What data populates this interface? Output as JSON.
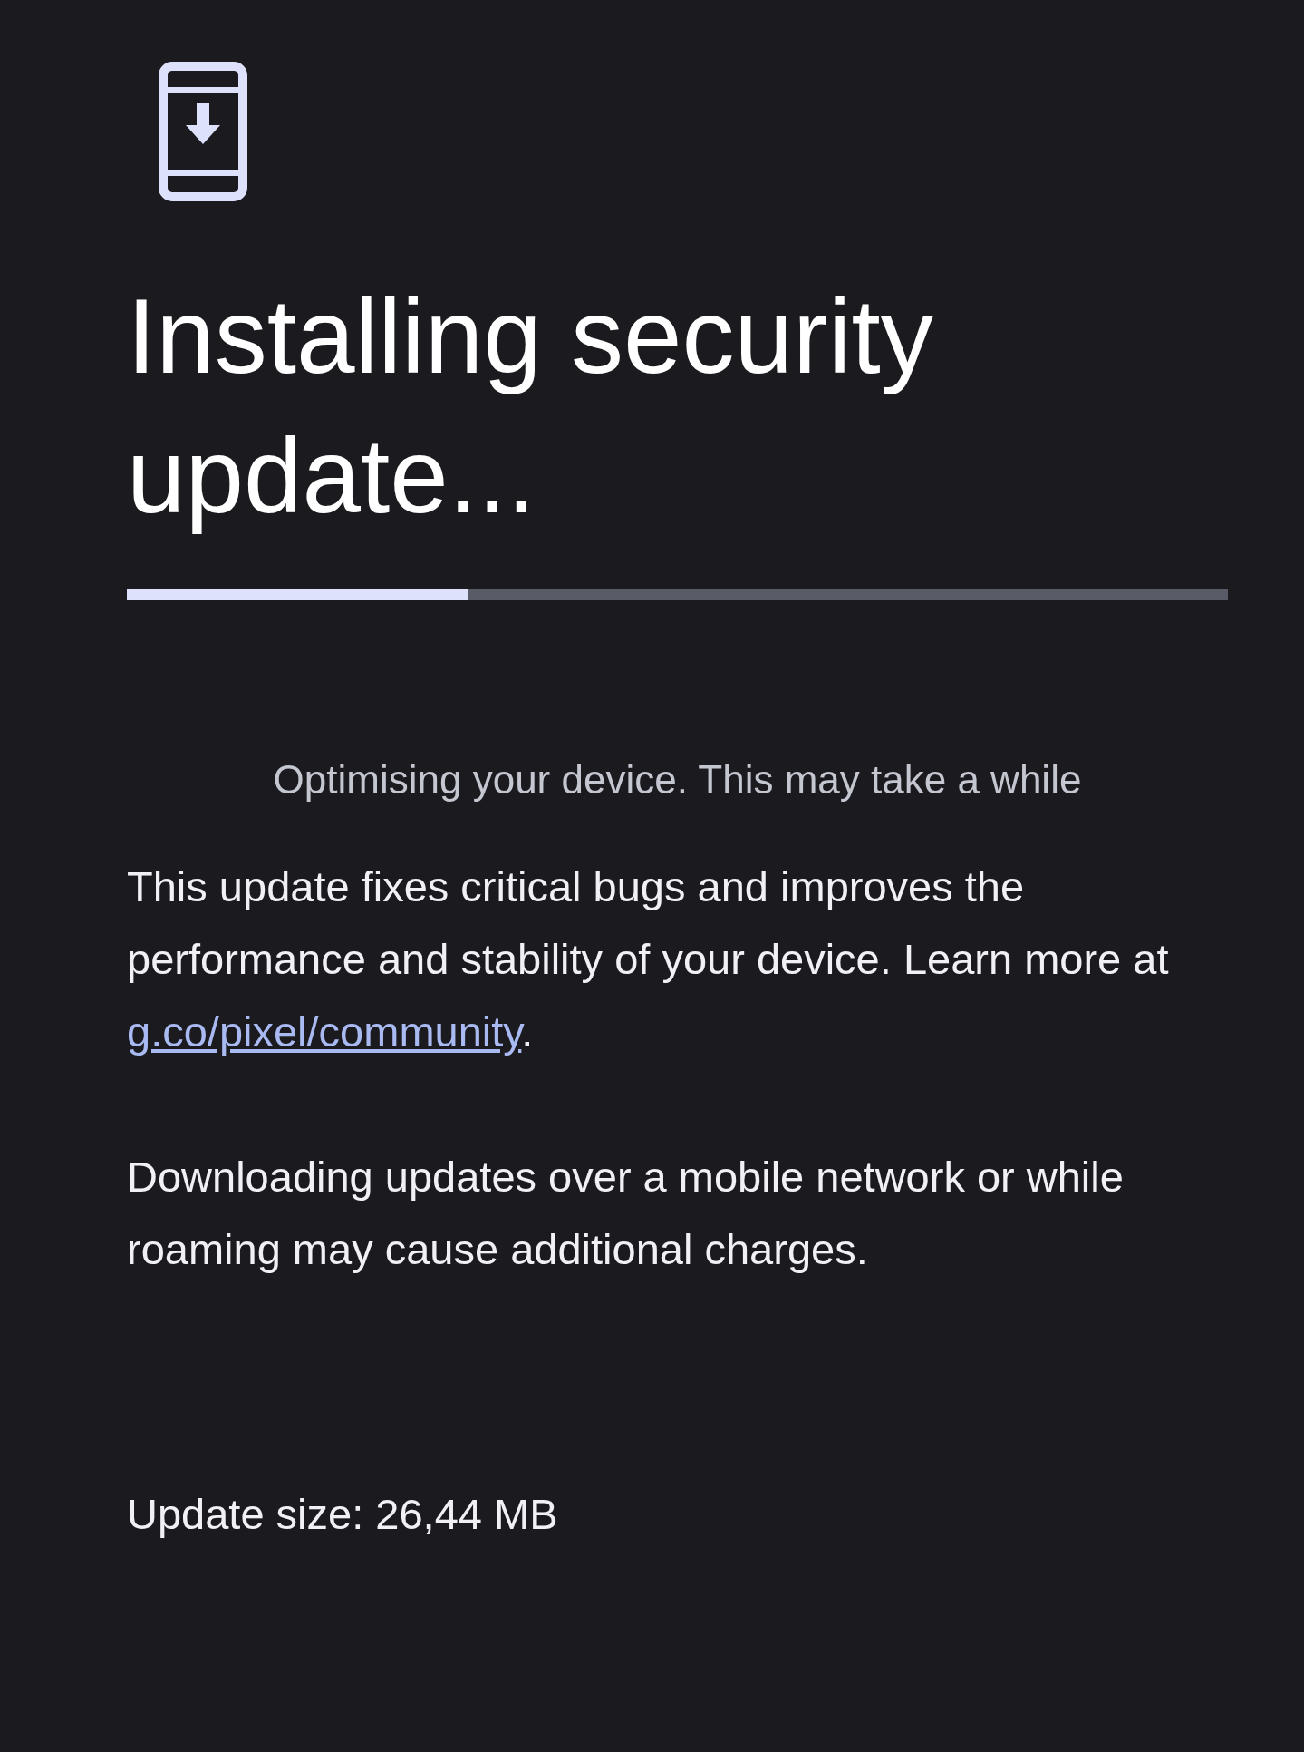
{
  "title": "Installing security update...",
  "progress": {
    "level": 0.31
  },
  "status": "Optimising your device. This may take a while",
  "description": {
    "text": "This update fixes critical bugs and improves the performance and stability of your device. Learn more at ",
    "link": "g.co/pixel/community",
    "after": "."
  },
  "note": "Downloading updates over a mobile network or while roaming may cause additional charges.",
  "update_size": "Update size: 26,44 MB"
}
